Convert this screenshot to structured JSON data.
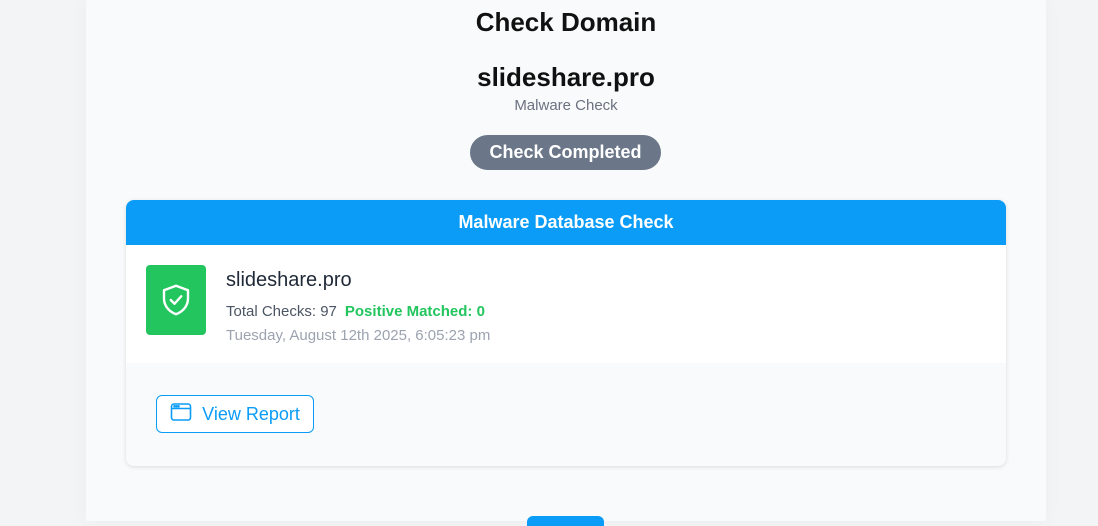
{
  "page": {
    "title": "Check Domain",
    "domain": "slideshare.pro",
    "subtitle": "Malware Check",
    "status": "Check Completed"
  },
  "card": {
    "header": "Malware Database Check",
    "icon": "shield-check-icon",
    "domain": "slideshare.pro",
    "total_checks_label": "Total Checks: 97",
    "positive_matched_label": "Positive Matched: 0",
    "timestamp": "Tuesday, August 12th 2025, 6:05:23 pm",
    "view_report_label": "View Report",
    "view_report_icon": "browser-window-icon"
  },
  "colors": {
    "accent": "#0a9cf7",
    "success": "#22c55e",
    "badge": "#6b7789"
  }
}
